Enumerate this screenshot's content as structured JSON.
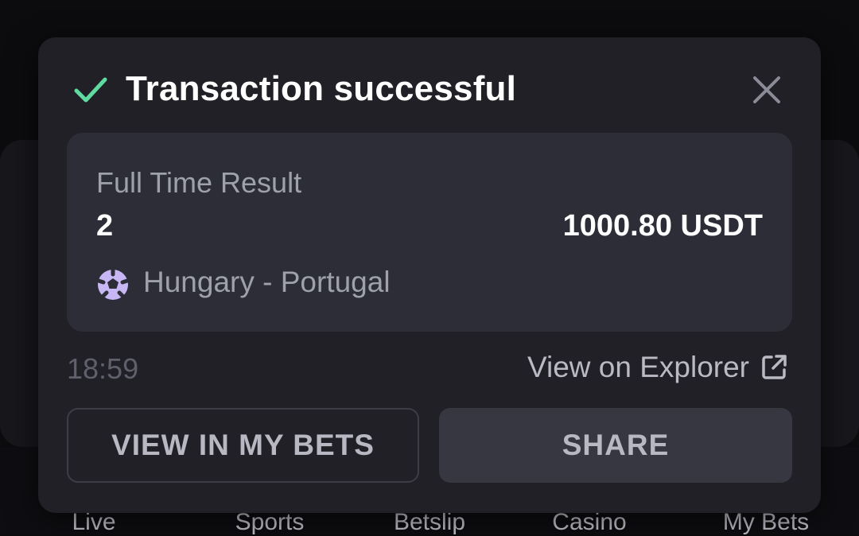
{
  "toast": {
    "title": "Transaction successful",
    "status_icon": "check-icon",
    "status_color": "#5fdba0",
    "close_icon": "close-icon"
  },
  "bet": {
    "market": "Full Time Result",
    "selection": "2",
    "amount": "1000.80 USDT",
    "sport_icon": "soccer-ball-icon",
    "match": "Hungary - Portugal"
  },
  "footer": {
    "time": "18:59",
    "explorer_label": "View on Explorer",
    "explorer_icon": "external-link-icon"
  },
  "actions": {
    "view_bets_label": "VIEW IN MY BETS",
    "share_label": "SHARE"
  },
  "nav": {
    "items": [
      "Live",
      "Sports",
      "Betslip",
      "Casino",
      "My Bets"
    ]
  }
}
